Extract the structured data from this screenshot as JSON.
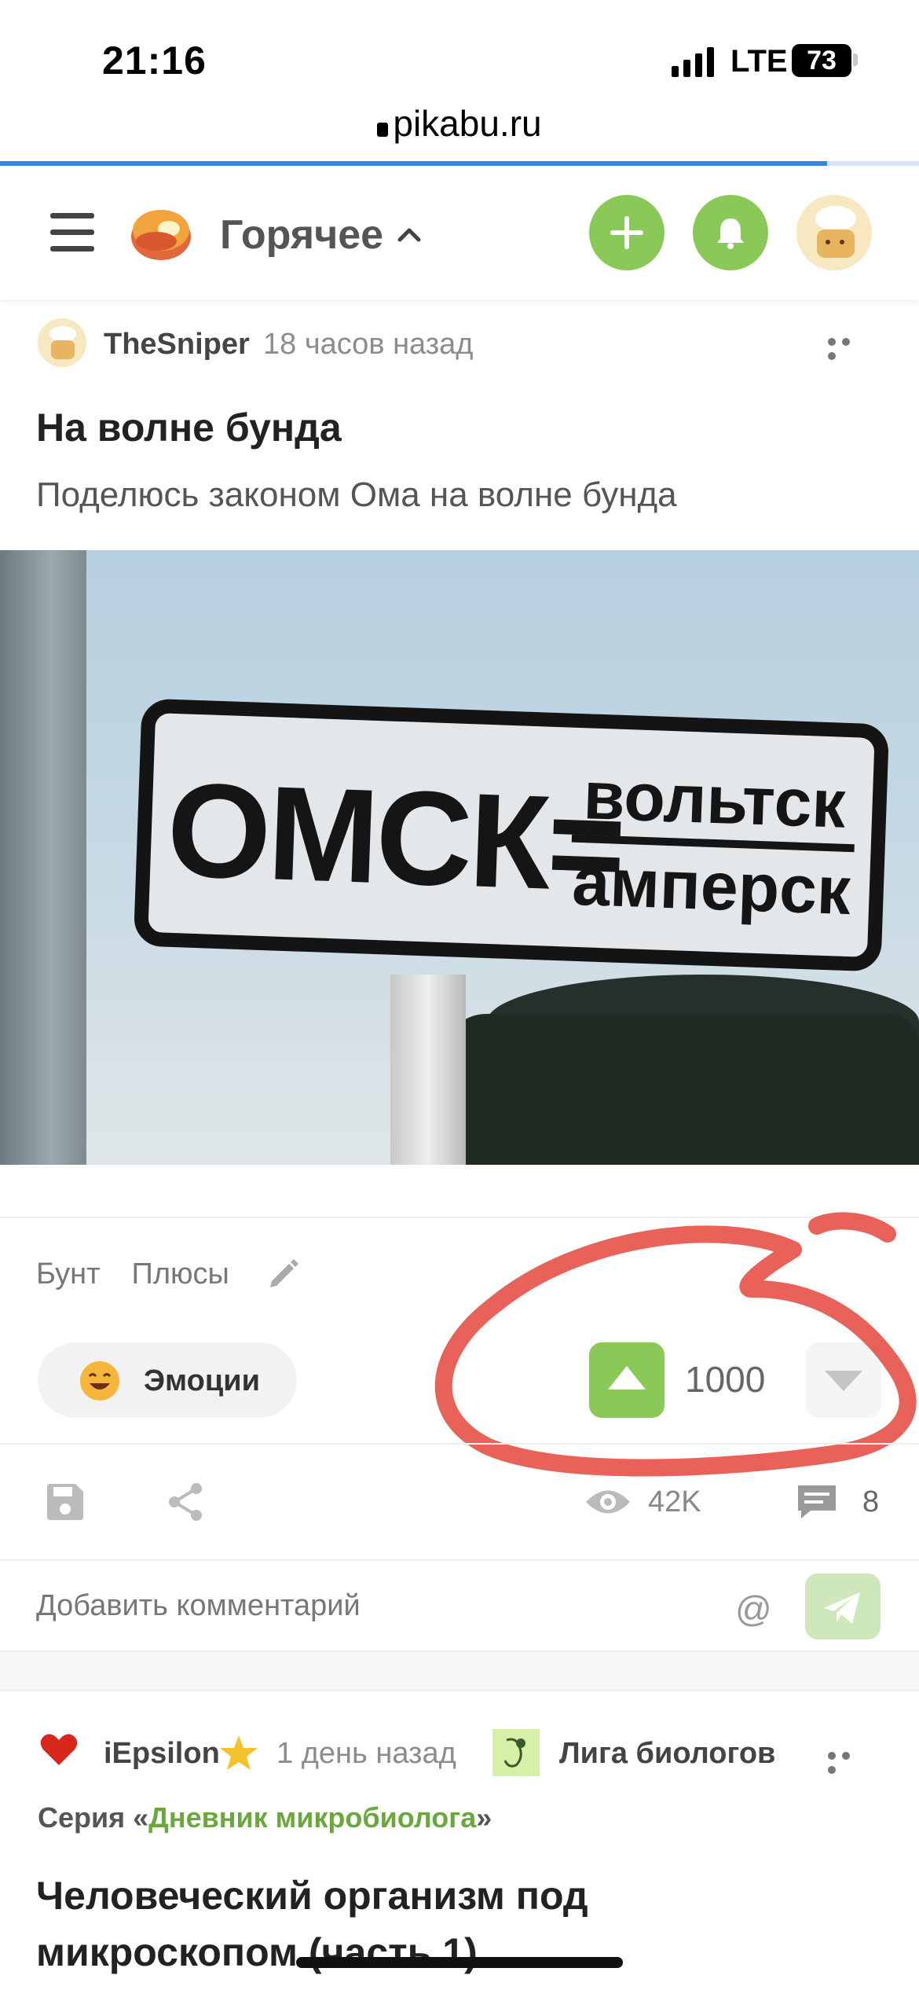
{
  "status_bar": {
    "time": "21:16",
    "network": "LTE",
    "battery": "73"
  },
  "browser": {
    "url": "pikabu.ru",
    "load_progress_percent": 90
  },
  "header": {
    "feed_title": "Горячее",
    "accent_color": "#8ac858"
  },
  "post1": {
    "author": "TheSniper",
    "time_ago": "18 часов назад",
    "title": "На волне бунда",
    "description": "Поделюсь законом Ома на волне бунда",
    "image_text": {
      "left": "ОМСК=",
      "numerator": "вольтск",
      "denominator": "амперск"
    },
    "tags": [
      "Бунт",
      "Плюсы"
    ],
    "emotions_label": "Эмоции",
    "rating": "1000",
    "views": "42K",
    "comments": "8"
  },
  "comment_box": {
    "placeholder": "Добавить комментарий",
    "at_symbol": "@"
  },
  "post2": {
    "author": "iEpsilon",
    "time_ago": "1 день назад",
    "community": "Лига биологов",
    "series_prefix": "Серия «",
    "series_name": "Дневник микробиолога",
    "series_suffix": "»",
    "title": "Человеческий организм под микроскопом (часть 1)"
  }
}
